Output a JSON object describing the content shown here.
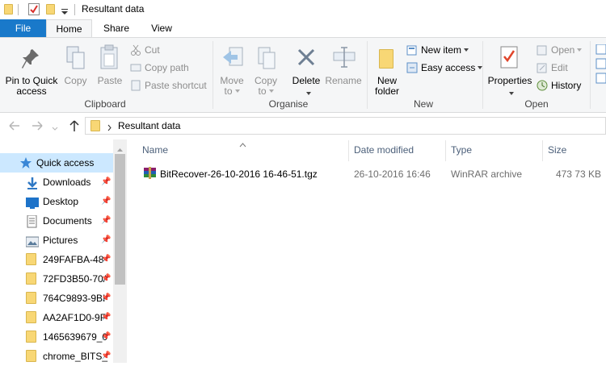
{
  "window": {
    "title": "Resultant data"
  },
  "tabs": {
    "file": "File",
    "home": "Home",
    "share": "Share",
    "view": "View"
  },
  "ribbon": {
    "clipboard": {
      "pin_label_1": "Pin to Quick",
      "pin_label_2": "access",
      "copy": "Copy",
      "paste": "Paste",
      "cut": "Cut",
      "copy_path": "Copy path",
      "paste_shortcut": "Paste shortcut",
      "group": "Clipboard"
    },
    "organise": {
      "move_1": "Move",
      "move_2": "to",
      "copy_1": "Copy",
      "copy_2": "to",
      "delete": "Delete",
      "rename": "Rename",
      "group": "Organise"
    },
    "new": {
      "folder_1": "New",
      "folder_2": "folder",
      "new_item": "New item",
      "easy_access": "Easy access",
      "group": "New"
    },
    "open": {
      "properties": "Properties",
      "open": "Open",
      "edit": "Edit",
      "history": "History",
      "group": "Open"
    }
  },
  "address": {
    "crumb": "Resultant data"
  },
  "nav": [
    {
      "label": "Quick access",
      "icon": "star-icon"
    },
    {
      "label": "Downloads",
      "icon": "download-icon",
      "pinned": true
    },
    {
      "label": "Desktop",
      "icon": "desktop-icon",
      "pinned": true
    },
    {
      "label": "Documents",
      "icon": "documents-icon",
      "pinned": true
    },
    {
      "label": "Pictures",
      "icon": "pictures-icon",
      "pinned": true
    },
    {
      "label": "249FAFBA-48",
      "icon": "folder-icon",
      "pinned": true
    },
    {
      "label": "72FD3B50-70/",
      "icon": "folder-icon",
      "pinned": true
    },
    {
      "label": "764C9893-9BI",
      "icon": "folder-icon",
      "pinned": true
    },
    {
      "label": "AA2AF1D0-9F",
      "icon": "folder-icon",
      "pinned": true
    },
    {
      "label": "1465639679_0",
      "icon": "folder-icon",
      "pinned": true
    },
    {
      "label": "chrome_BITS_",
      "icon": "folder-icon",
      "pinned": true
    }
  ],
  "columns": {
    "name": "Name",
    "date": "Date modified",
    "type": "Type",
    "size": "Size"
  },
  "files": [
    {
      "name": "BitRecover-26-10-2016 16-46-51.tgz",
      "date": "26-10-2016 16:46",
      "type": "WinRAR archive",
      "size": "473 73 KB"
    }
  ],
  "colors": {
    "file_tab": "#1979ca",
    "selection": "#cce8ff",
    "ribbon_bg": "#f5f6f7"
  }
}
